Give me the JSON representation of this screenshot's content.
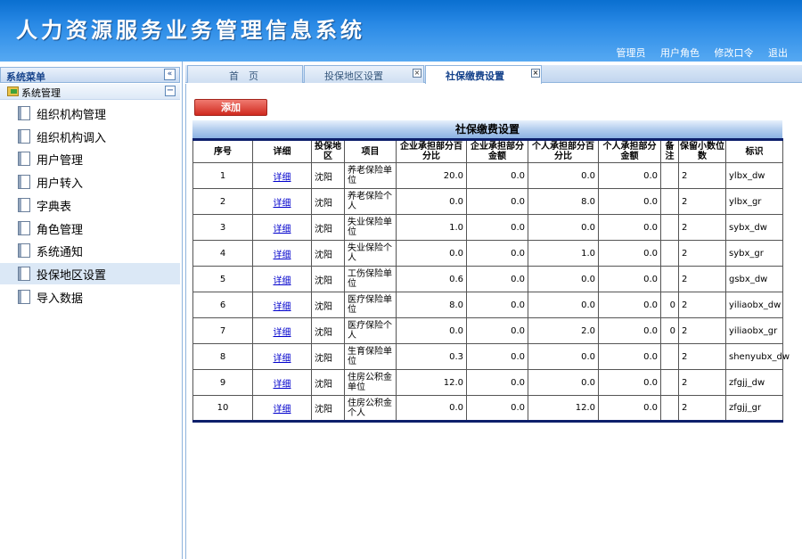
{
  "header": {
    "title": "人力资源服务业务管理信息系统",
    "links": [
      "管理员",
      "用户角色",
      "修改口令",
      "退出"
    ]
  },
  "sidebar": {
    "title": "系统菜单",
    "collapse_icon": "«",
    "group": "系统管理",
    "group_toggle": "−",
    "items": [
      {
        "label": "组织机构管理"
      },
      {
        "label": "组织机构调入"
      },
      {
        "label": "用户管理"
      },
      {
        "label": "用户转入"
      },
      {
        "label": "字典表"
      },
      {
        "label": "角色管理"
      },
      {
        "label": "系统通知"
      },
      {
        "label": "投保地区设置"
      },
      {
        "label": "导入数据"
      }
    ]
  },
  "tabs": [
    {
      "label": "首　页",
      "closable": false
    },
    {
      "label": "投保地区设置",
      "closable": true
    },
    {
      "label": "社保缴费设置",
      "closable": true,
      "active": true
    }
  ],
  "tab_close_icon": "×",
  "toolbar": {
    "add_label": "添加"
  },
  "grid": {
    "title": "社保缴费设置",
    "columns": [
      "序号",
      "详细",
      "投保地区",
      "项目",
      "企业承担部分百分比",
      "企业承担部分金额",
      "个人承担部分百分比",
      "个人承担部分金额",
      "备注",
      "保留小数位数",
      "标识"
    ],
    "rows": [
      {
        "no": "1",
        "detail": "详细",
        "region": "沈阳",
        "item": "养老保险单位",
        "c_pct": "20.0",
        "c_amt": "0.0",
        "p_pct": "0.0",
        "p_amt": "0.0",
        "note": "",
        "dec": "2",
        "code": "ylbx_dw"
      },
      {
        "no": "2",
        "detail": "详细",
        "region": "沈阳",
        "item": "养老保险个人",
        "c_pct": "0.0",
        "c_amt": "0.0",
        "p_pct": "8.0",
        "p_amt": "0.0",
        "note": "",
        "dec": "2",
        "code": "ylbx_gr"
      },
      {
        "no": "3",
        "detail": "详细",
        "region": "沈阳",
        "item": "失业保险单位",
        "c_pct": "1.0",
        "c_amt": "0.0",
        "p_pct": "0.0",
        "p_amt": "0.0",
        "note": "",
        "dec": "2",
        "code": "sybx_dw"
      },
      {
        "no": "4",
        "detail": "详细",
        "region": "沈阳",
        "item": "失业保险个人",
        "c_pct": "0.0",
        "c_amt": "0.0",
        "p_pct": "1.0",
        "p_amt": "0.0",
        "note": "",
        "dec": "2",
        "code": "sybx_gr"
      },
      {
        "no": "5",
        "detail": "详细",
        "region": "沈阳",
        "item": "工伤保险单位",
        "c_pct": "0.6",
        "c_amt": "0.0",
        "p_pct": "0.0",
        "p_amt": "0.0",
        "note": "",
        "dec": "2",
        "code": "gsbx_dw"
      },
      {
        "no": "6",
        "detail": "详细",
        "region": "沈阳",
        "item": "医疗保险单位",
        "c_pct": "8.0",
        "c_amt": "0.0",
        "p_pct": "0.0",
        "p_amt": "0.0",
        "note": "0",
        "dec": "2",
        "code": "yiliaobx_dw"
      },
      {
        "no": "7",
        "detail": "详细",
        "region": "沈阳",
        "item": "医疗保险个人",
        "c_pct": "0.0",
        "c_amt": "0.0",
        "p_pct": "2.0",
        "p_amt": "0.0",
        "note": "0",
        "dec": "2",
        "code": "yiliaobx_gr"
      },
      {
        "no": "8",
        "detail": "详细",
        "region": "沈阳",
        "item": "生育保险单位",
        "c_pct": "0.3",
        "c_amt": "0.0",
        "p_pct": "0.0",
        "p_amt": "0.0",
        "note": "",
        "dec": "2",
        "code": "shenyubx_dw"
      },
      {
        "no": "9",
        "detail": "详细",
        "region": "沈阳",
        "item": "住房公积金单位",
        "c_pct": "12.0",
        "c_amt": "0.0",
        "p_pct": "0.0",
        "p_amt": "0.0",
        "note": "",
        "dec": "2",
        "code": "zfgjj_dw"
      },
      {
        "no": "10",
        "detail": "详细",
        "region": "沈阳",
        "item": "住房公积金个人",
        "c_pct": "0.0",
        "c_amt": "0.0",
        "p_pct": "12.0",
        "p_amt": "0.0",
        "note": "",
        "dec": "2",
        "code": "zfgjj_gr"
      }
    ]
  }
}
